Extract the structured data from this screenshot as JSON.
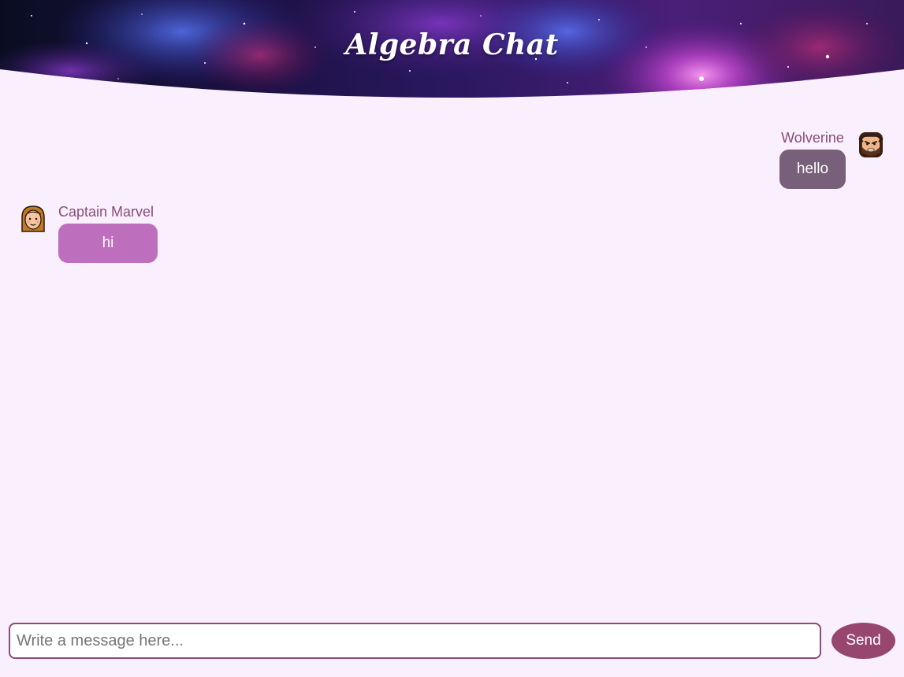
{
  "app": {
    "title": "Algebra Chat"
  },
  "messages": [
    {
      "sender": "Wolverine",
      "text": "hello",
      "side": "right",
      "avatar_icon": "wolverine-avatar-icon",
      "bubble_color": "#785f7a"
    },
    {
      "sender": "Captain Marvel",
      "text": "hi",
      "side": "left",
      "avatar_icon": "captain-marvel-avatar-icon",
      "bubble_color": "#bd6ebd"
    }
  ],
  "composer": {
    "placeholder": "Write a message here...",
    "value": "",
    "send_label": "Send"
  },
  "colors": {
    "background": "#faeffc",
    "accent": "#96466f",
    "sender_name": "#8a4c79"
  }
}
